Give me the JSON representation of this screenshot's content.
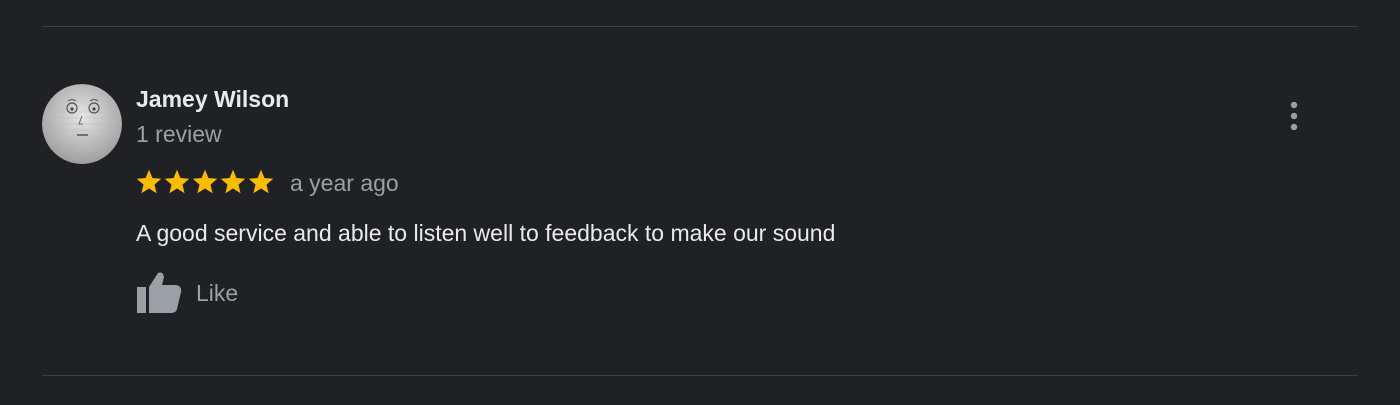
{
  "review": {
    "author_name": "Jamey Wilson",
    "review_count": "1 review",
    "rating": 5,
    "max_rating": 5,
    "time": "a year ago",
    "text": "A good service and able to listen well to feedback to make our sound",
    "like_label": "Like"
  },
  "icons": {
    "avatar": "user-avatar-face",
    "stars": "star-icon",
    "like": "thumbs-up-icon",
    "more": "more-vert-icon"
  },
  "colors": {
    "background": "#202124",
    "star": "#fbbc04",
    "primary_text": "#e8eaed",
    "secondary_text": "#9aa0a6",
    "divider": "#3c4043"
  }
}
